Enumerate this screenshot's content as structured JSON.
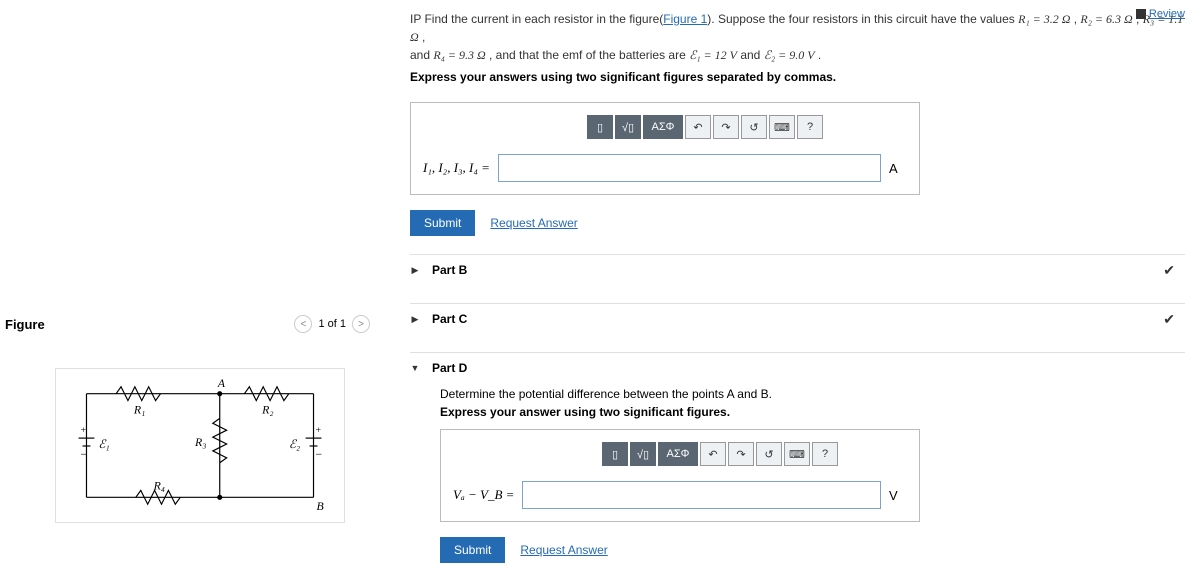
{
  "review": "Review",
  "problem": {
    "prefix": "IP Find the current in each resistor in the figure(",
    "figlink": "Figure 1",
    "mid1": "). Suppose the four resistors in this circuit have the values ",
    "r1": "R₁ = 3.2 Ω",
    "r2": "R₂ = 6.3 Ω",
    "r3": "R₃ = 1.1 Ω",
    "mid2": " and ",
    "r4": "R₄ = 9.3 Ω",
    "mid3": " , and that the emf of the batteries are ",
    "e1": "ℰ₁ = 12 V",
    "e2": "ℰ₂ = 9.0 V",
    "suffix": " .",
    "instruction": "Express your answers using two significant figures separated by commas."
  },
  "partA": {
    "var_label": "I₁, I₂, I₃, I₄ =",
    "unit": "A",
    "submit": "Submit",
    "request": "Request Answer"
  },
  "toolbar": {
    "tmpl": "▯",
    "sqrt": "√▯",
    "greek": "ΑΣΦ",
    "undo": "↶",
    "redo": "↷",
    "reset": "↺",
    "keyb": "⌨",
    "help": "?"
  },
  "partB": {
    "label": "Part B"
  },
  "partC": {
    "label": "Part C"
  },
  "partD": {
    "label": "Part D",
    "text1": "Determine the potential difference between the points A and B.",
    "text2": "Express your answer using two significant figures.",
    "var_label": "Vₐ − V_B =",
    "unit": "V",
    "submit": "Submit",
    "request": "Request Answer"
  },
  "figure": {
    "title": "Figure",
    "nav": "1 of 1",
    "labels": {
      "A": "A",
      "B": "B",
      "R1": "R₁",
      "R2": "R₂",
      "R3": "R₃",
      "R4": "R₄",
      "E1": "ℰ₁",
      "E2": "ℰ₂"
    }
  }
}
